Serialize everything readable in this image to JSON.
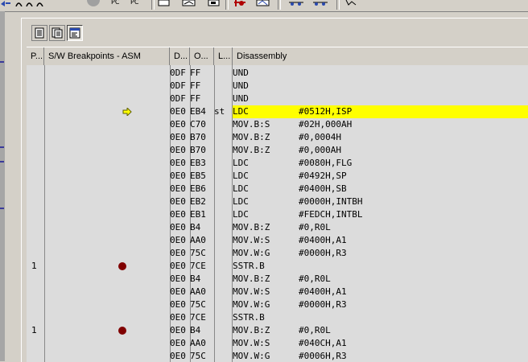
{
  "top_toolbar": {
    "pc_label_1": "PC",
    "pc_label_2": "PC"
  },
  "columns": {
    "pass": "P...",
    "breakpoints": "S/W Breakpoints - ASM",
    "address": "D...",
    "opcode": "O...",
    "label": "L...",
    "disassembly": "Disassembly"
  },
  "rows": [
    {
      "pass": "",
      "bp": false,
      "pc": false,
      "addr": "0DF",
      "opc": "FF",
      "label": "",
      "mn": "UND",
      "op": ""
    },
    {
      "pass": "",
      "bp": false,
      "pc": false,
      "addr": "0DF",
      "opc": "FF",
      "label": "",
      "mn": "UND",
      "op": ""
    },
    {
      "pass": "",
      "bp": false,
      "pc": false,
      "addr": "0DF",
      "opc": "FF",
      "label": "",
      "mn": "UND",
      "op": ""
    },
    {
      "pass": "",
      "bp": false,
      "pc": true,
      "addr": "0E0",
      "opc": "EB4",
      "label": "st",
      "mn": "LDC",
      "op": "#0512H,ISP"
    },
    {
      "pass": "",
      "bp": false,
      "pc": false,
      "addr": "0E0",
      "opc": "C70",
      "label": "",
      "mn": "MOV.B:S",
      "op": "#02H,000AH"
    },
    {
      "pass": "",
      "bp": false,
      "pc": false,
      "addr": "0E0",
      "opc": "B70",
      "label": "",
      "mn": "MOV.B:Z",
      "op": "#0,0004H"
    },
    {
      "pass": "",
      "bp": false,
      "pc": false,
      "addr": "0E0",
      "opc": "B70",
      "label": "",
      "mn": "MOV.B:Z",
      "op": "#0,000AH"
    },
    {
      "pass": "",
      "bp": false,
      "pc": false,
      "addr": "0E0",
      "opc": "EB3",
      "label": "",
      "mn": "LDC",
      "op": "#0080H,FLG"
    },
    {
      "pass": "",
      "bp": false,
      "pc": false,
      "addr": "0E0",
      "opc": "EB5",
      "label": "",
      "mn": "LDC",
      "op": "#0492H,SP"
    },
    {
      "pass": "",
      "bp": false,
      "pc": false,
      "addr": "0E0",
      "opc": "EB6",
      "label": "",
      "mn": "LDC",
      "op": "#0400H,SB"
    },
    {
      "pass": "",
      "bp": false,
      "pc": false,
      "addr": "0E0",
      "opc": "EB2",
      "label": "",
      "mn": "LDC",
      "op": "#0000H,INTBH"
    },
    {
      "pass": "",
      "bp": false,
      "pc": false,
      "addr": "0E0",
      "opc": "EB1",
      "label": "",
      "mn": "LDC",
      "op": "#FEDCH,INTBL"
    },
    {
      "pass": "",
      "bp": false,
      "pc": false,
      "addr": "0E0",
      "opc": "B4",
      "label": "",
      "mn": "MOV.B:Z",
      "op": "#0,R0L"
    },
    {
      "pass": "",
      "bp": false,
      "pc": false,
      "addr": "0E0",
      "opc": "AA0",
      "label": "",
      "mn": "MOV.W:S",
      "op": "#0400H,A1"
    },
    {
      "pass": "",
      "bp": false,
      "pc": false,
      "addr": "0E0",
      "opc": "75C",
      "label": "",
      "mn": "MOV.W:G",
      "op": "#0000H,R3"
    },
    {
      "pass": "1",
      "bp": true,
      "pc": false,
      "addr": "0E0",
      "opc": "7CE",
      "label": "",
      "mn": "SSTR.B",
      "op": ""
    },
    {
      "pass": "",
      "bp": false,
      "pc": false,
      "addr": "0E0",
      "opc": "B4",
      "label": "",
      "mn": "MOV.B:Z",
      "op": "#0,R0L"
    },
    {
      "pass": "",
      "bp": false,
      "pc": false,
      "addr": "0E0",
      "opc": "AA0",
      "label": "",
      "mn": "MOV.W:S",
      "op": "#0400H,A1"
    },
    {
      "pass": "",
      "bp": false,
      "pc": false,
      "addr": "0E0",
      "opc": "75C",
      "label": "",
      "mn": "MOV.W:G",
      "op": "#0000H,R3"
    },
    {
      "pass": "",
      "bp": false,
      "pc": false,
      "addr": "0E0",
      "opc": "7CE",
      "label": "",
      "mn": "SSTR.B",
      "op": ""
    },
    {
      "pass": "1",
      "bp": true,
      "pc": false,
      "addr": "0E0",
      "opc": "B4",
      "label": "",
      "mn": "MOV.B:Z",
      "op": "#0,R0L"
    },
    {
      "pass": "",
      "bp": false,
      "pc": false,
      "addr": "0E0",
      "opc": "AA0",
      "label": "",
      "mn": "MOV.W:S",
      "op": "#040CH,A1"
    },
    {
      "pass": "",
      "bp": false,
      "pc": false,
      "addr": "0E0",
      "opc": "75C",
      "label": "",
      "mn": "MOV.W:G",
      "op": "#0006H,R3"
    }
  ],
  "colors": {
    "current_line": "#ffff00",
    "breakpoint": "#800000",
    "pc_arrow": "#ffff00"
  }
}
